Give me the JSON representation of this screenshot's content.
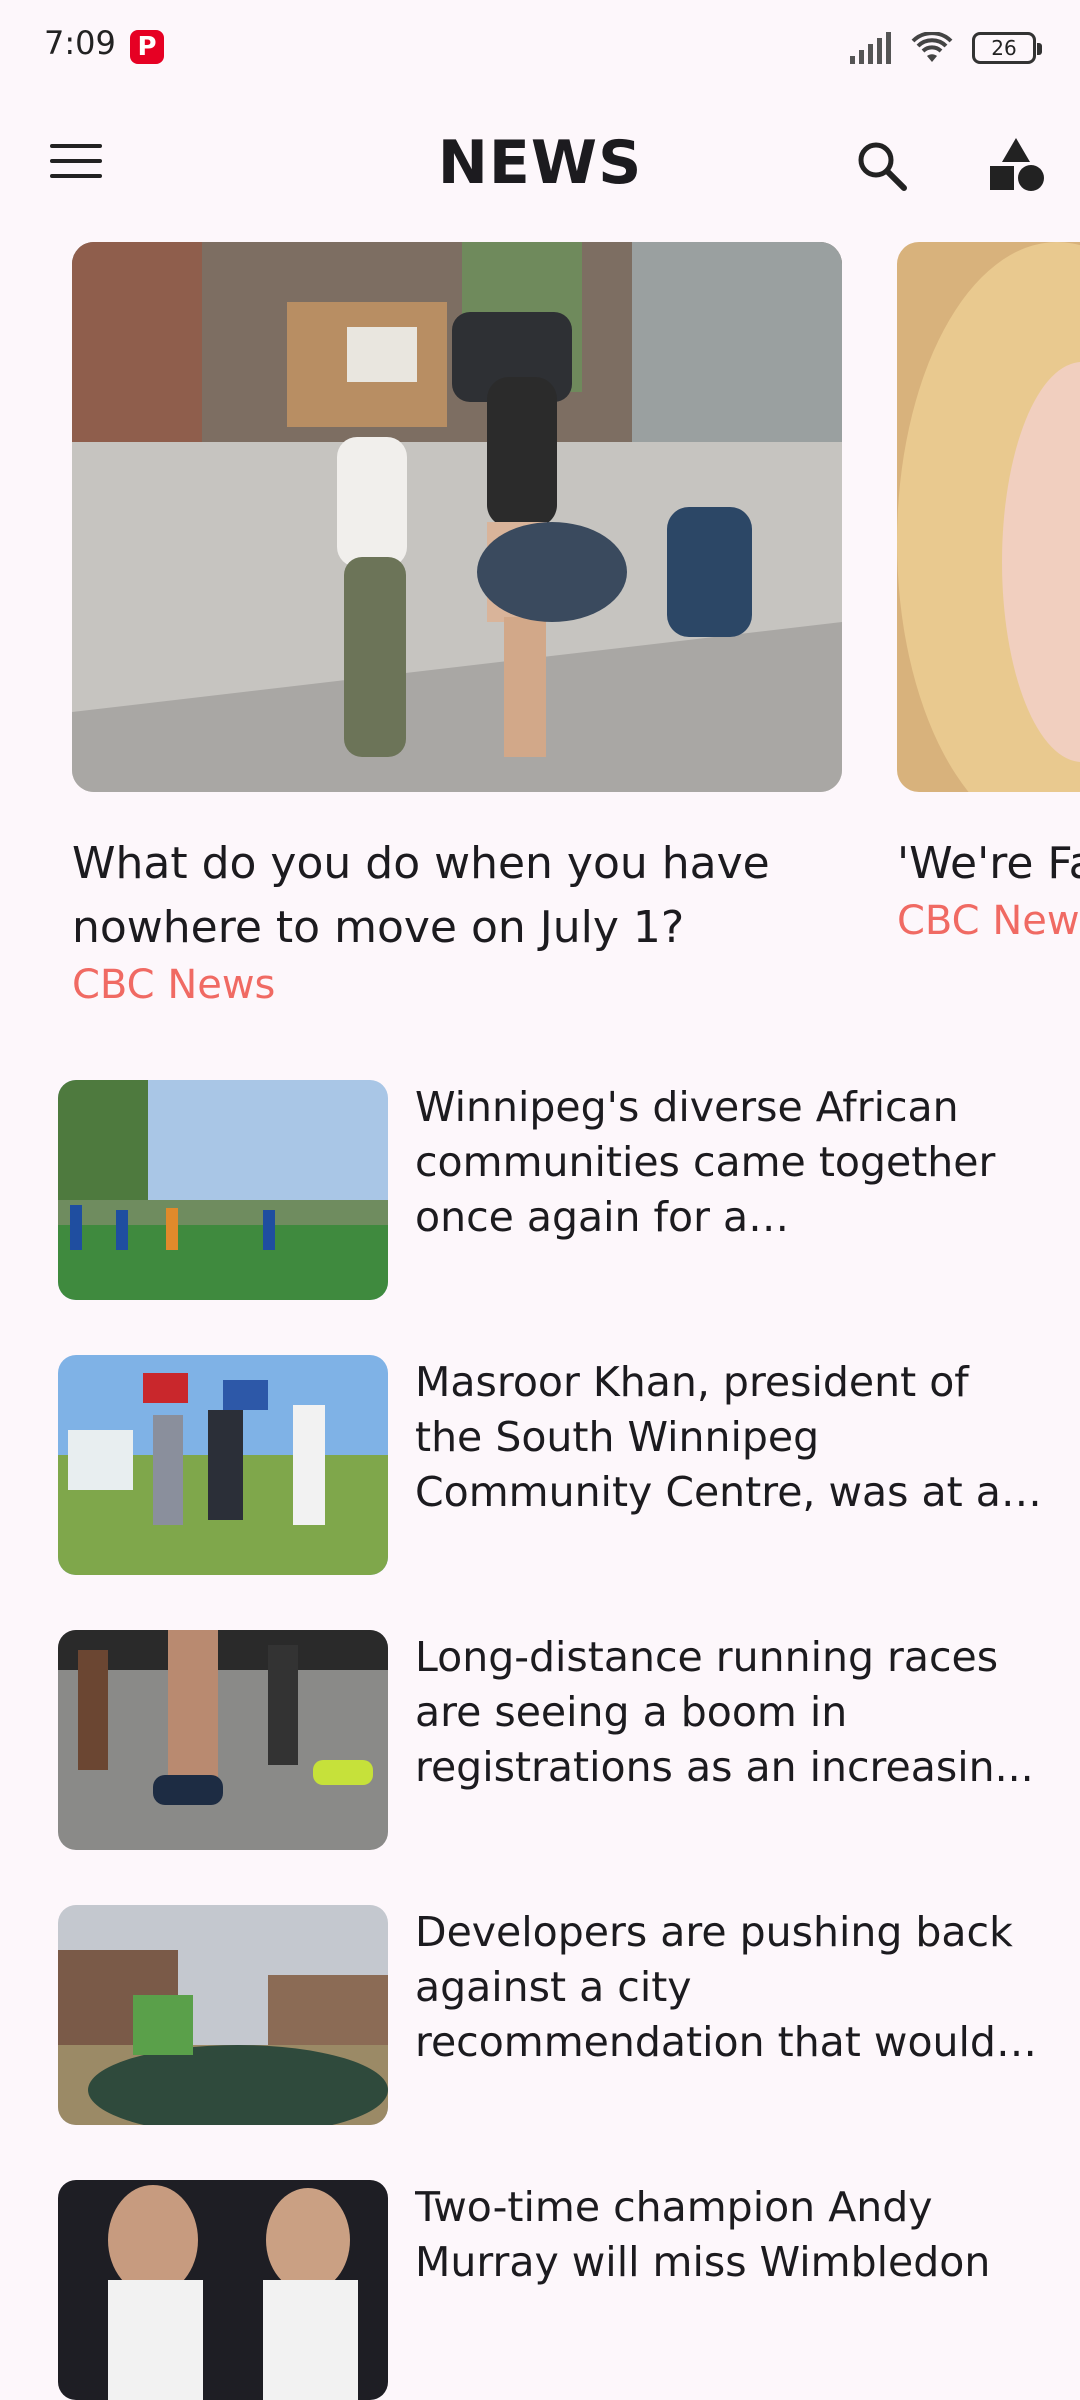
{
  "status_bar": {
    "time": "7:09",
    "notification_app": "P",
    "battery": "26"
  },
  "header": {
    "title": "NEWS"
  },
  "featured": [
    {
      "title": "What do you do when you have nowhere to move on July 1?",
      "source": "CBC News"
    },
    {
      "title": "'We're Family",
      "source": "CBC News"
    }
  ],
  "articles": [
    {
      "title": "Winnipeg's diverse African communities came together once again for a competition..."
    },
    {
      "title": "Masroor Khan, president of the South Winnipeg Community Centre, was at a ..."
    },
    {
      "title": "Long-distance running races are seeing a boom in registrations as an increasin..."
    },
    {
      "title": "Developers are pushing back against a city recommendation that would ..."
    },
    {
      "title": "Two-time champion Andy Murray will miss Wimbledon"
    }
  ],
  "colors": {
    "background": "#fdf7fb",
    "source_accent": "#f06a63",
    "pinterest": "#e60023"
  }
}
